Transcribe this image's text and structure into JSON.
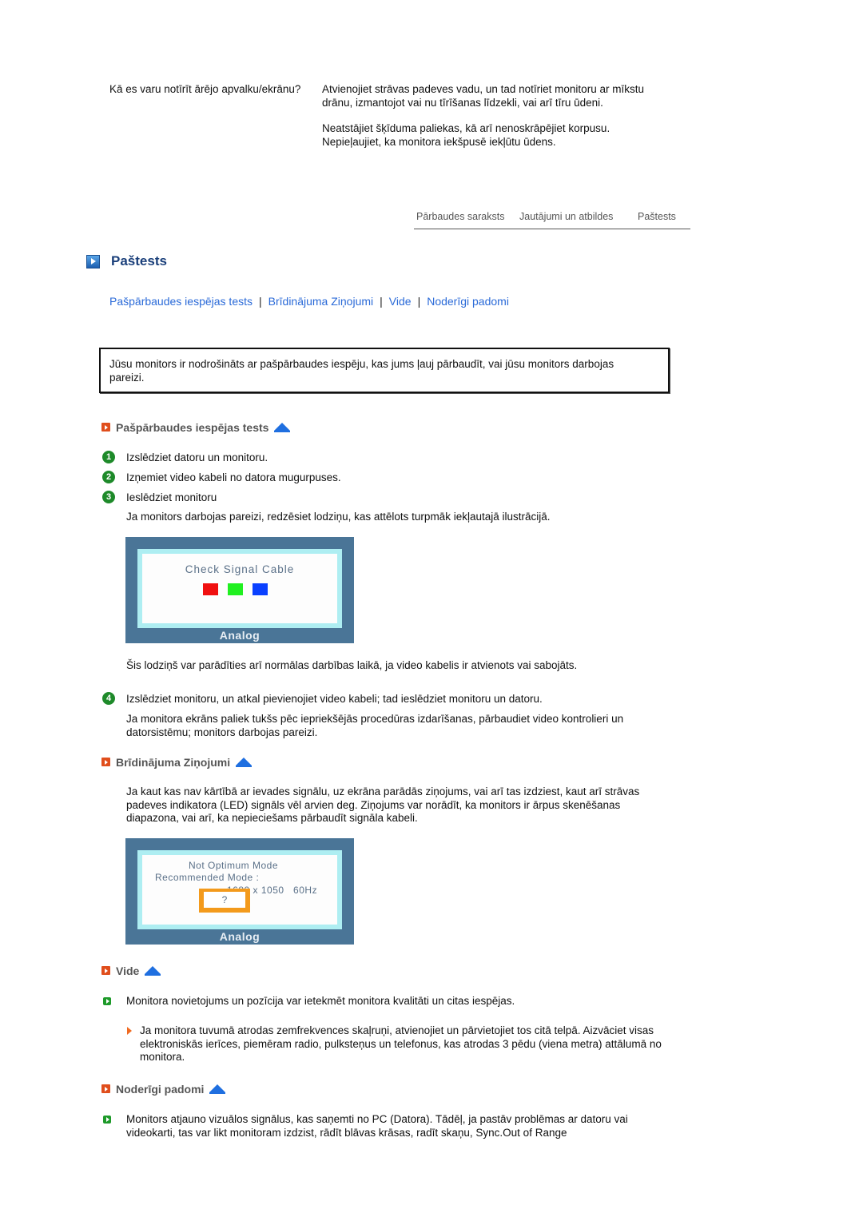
{
  "faq": {
    "question": "Kā es varu notīrīt ārējo apvalku/ekrānu?",
    "answer": [
      "Atvienojiet strāvas padeves vadu, un tad notīriet monitoru ar mīkstu drānu, izmantojot vai nu tīrīšanas līdzekli, vai arī tīru ūdeni.",
      "Neatstājiet šķīduma paliekas, kā arī nenoskrāpējiet korpusu. Nepieļaujiet, ka monitora iekšpusē iekļūtu ūdens."
    ]
  },
  "top_nav": {
    "items": [
      "Pārbaudes saraksts",
      "Jautājumi un atbildes",
      "Paštests"
    ]
  },
  "page": {
    "title": "Paštests",
    "title_icon": "blue-play-square-icon"
  },
  "anchor_links": {
    "items": [
      "Pašpārbaudes iespējas tests",
      "Brīdinājuma Ziņojumi",
      "Vide",
      "Noderīgi padomi"
    ],
    "separator": "|"
  },
  "intro": {
    "text": "Jūsu monitors ir nodrošināts ar pašpārbaudes iespēju, kas jums ļauj pārbaudīt, vai jūsu monitors darbojas pareizi."
  },
  "sections": {
    "self_test": {
      "heading": "Pašpārbaudes iespējas tests",
      "steps": [
        {
          "num": "1",
          "text": "Izslēdziet datoru un monitoru."
        },
        {
          "num": "2",
          "text": "Izņemiet video kabeli no datora mugurpuses."
        },
        {
          "num": "3",
          "text": "Ieslēdziet monitoru"
        }
      ],
      "after_step3": "Ja monitors darbojas pareizi, redzēsiet lodziņu, kas attēlots turpmāk iekļautajā ilustrācijā.",
      "osd": {
        "title": "Check Signal Cable",
        "squares": [
          "#f01010",
          "#20f020",
          "#0a40ff"
        ],
        "footer": "Analog"
      },
      "note": "Šis lodziņš var parādīties arī normālas darbības laikā, ja video kabelis ir atvienots vai sabojāts.",
      "step4": {
        "num": "4",
        "text": "Izslēdziet monitoru, un atkal pievienojiet video kabeli; tad ieslēdziet monitoru un datoru."
      },
      "after_step4": "Ja monitora ekrāns paliek tukšs pēc iepriekšējās procedūras izdarīšanas, pārbaudiet video kontrolieri un datorsistēmu; monitors darbojas pareizi."
    },
    "warnings": {
      "heading": "Brīdinājuma Ziņojumi",
      "text": "Ja kaut kas nav kārtībā ar ievades signālu, uz ekrāna parādās ziņojums, vai arī tas izdziest, kaut arī strāvas padeves indikatora (LED) signāls vēl arvien deg. Ziņojums var norādīt, ka monitors ir ārpus skenēšanas diapazona, vai arī, ka nepieciešams pārbaudīt signāla kabeli.",
      "osd": {
        "line1": "Not Optimum Mode",
        "line2": "Recommended Mode :",
        "line3": "1680 x 1050   60Hz",
        "button": "?",
        "footer": "Analog"
      }
    },
    "environment": {
      "heading": "Vide",
      "bullet": "Monitora novietojums un pozīcija var ietekmēt monitora kvalitāti un citas iespējas.",
      "sub_bullet": "Ja monitora tuvumā atrodas zemfrekvences skaļruņi, atvienojiet un pārvietojiet tos citā telpā. Aizvāciet visas elektroniskās ierīces, piemēram radio, pulksteņus un telefonus, kas atrodas 3 pēdu (viena metra) attālumā no monitora."
    },
    "tips": {
      "heading": "Noderīgi padomi",
      "bullet": "Monitors atjauno vizuālos signālus, kas saņemti no PC (Datora). Tādēļ, ja pastāv problēmas ar datoru vai videokarti, tas var likt monitoram izdzist, rādīt blāvas krāsas, radīt skaņu, Sync.Out of Range"
    }
  },
  "colors": {
    "link": "#2a6ad8",
    "title": "#1a3f7a",
    "section_icon": "#e04e1c",
    "step_icon": "#1e8a2a",
    "up_arrow": "#1f6fe0",
    "osd_frame": "#4a7597",
    "osd_button_highlight": "#f39a1c"
  }
}
